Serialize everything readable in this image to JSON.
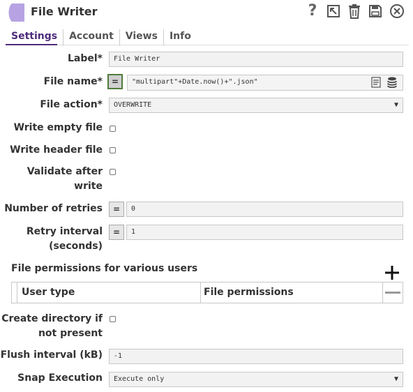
{
  "header": {
    "title": "File Writer",
    "accent": "#b7a3e3"
  },
  "tabs": [
    {
      "label": "Settings"
    },
    {
      "label": "Account"
    },
    {
      "label": "Views"
    },
    {
      "label": "Info"
    }
  ],
  "fields": {
    "label": {
      "label": "Label*",
      "value": "File Writer"
    },
    "file_name": {
      "label": "File name*",
      "eq": "=",
      "value": "\"multipart\"+Date.now()+\".json\""
    },
    "file_action": {
      "label": "File action*",
      "value": "OVERWRITE"
    },
    "write_empty": {
      "label": "Write empty file"
    },
    "write_header": {
      "label": "Write header file"
    },
    "validate_line1": "Validate after",
    "validate_line2": "write",
    "retries": {
      "label": "Number of retries",
      "eq": "=",
      "value": "0"
    },
    "retry_line1": "Retry interval",
    "retry_line2": "(seconds)",
    "retry_interval": {
      "eq": "=",
      "value": "1"
    },
    "permissions": {
      "section_label": "File permissions for various users",
      "col_user": "User type",
      "col_perm": "File permissions"
    },
    "create_dir_line1": "Create directory if",
    "create_dir_line2": "not present",
    "flush": {
      "label": "Flush interval (kB)",
      "value": "-1"
    },
    "snap_exec": {
      "label": "Snap Execution",
      "value": "Execute only"
    }
  },
  "icons": [
    "help-icon",
    "export-icon",
    "delete-icon",
    "save-icon",
    "close-icon",
    "notes-icon",
    "database-icon",
    "dropdown-arrow-icon",
    "add-icon",
    "remove-icon"
  ]
}
